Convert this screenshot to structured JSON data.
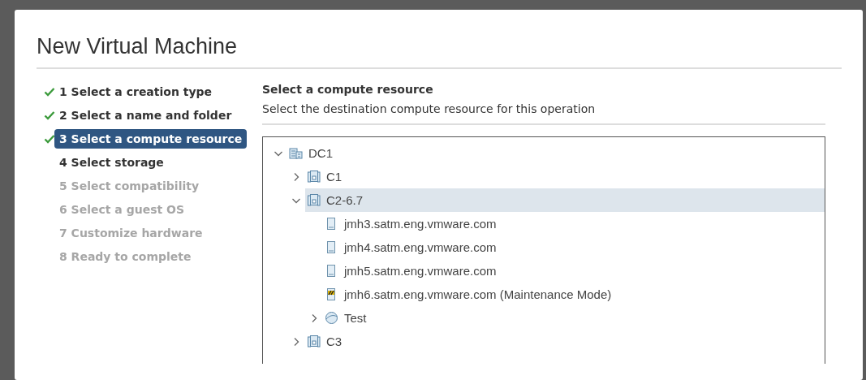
{
  "dialog": {
    "title": "New Virtual Machine"
  },
  "steps": [
    {
      "label": "1 Select a creation type",
      "done": true,
      "selected": false,
      "disabled": false
    },
    {
      "label": "2 Select a name and folder",
      "done": true,
      "selected": false,
      "disabled": false
    },
    {
      "label": "3 Select a compute resource",
      "done": true,
      "selected": true,
      "disabled": false
    },
    {
      "label": "4 Select storage",
      "done": false,
      "selected": false,
      "disabled": false
    },
    {
      "label": "5 Select compatibility",
      "done": false,
      "selected": false,
      "disabled": true
    },
    {
      "label": "6 Select a guest OS",
      "done": false,
      "selected": false,
      "disabled": true
    },
    {
      "label": "7 Customize hardware",
      "done": false,
      "selected": false,
      "disabled": true
    },
    {
      "label": "8 Ready to complete",
      "done": false,
      "selected": false,
      "disabled": true
    }
  ],
  "page": {
    "heading": "Select a compute resource",
    "description": "Select the destination compute resource for this operation"
  },
  "tree": [
    {
      "label": "DC1",
      "kind": "datacenter",
      "expanded": true,
      "selected": false,
      "children": [
        {
          "label": "C1",
          "kind": "cluster",
          "expanded": false,
          "selected": false
        },
        {
          "label": "C2-6.7",
          "kind": "cluster",
          "expanded": true,
          "selected": true,
          "children": [
            {
              "label": "jmh3.satm.eng.vmware.com",
              "kind": "host",
              "selected": false
            },
            {
              "label": "jmh4.satm.eng.vmware.com",
              "kind": "host",
              "selected": false
            },
            {
              "label": "jmh5.satm.eng.vmware.com",
              "kind": "host",
              "selected": false
            },
            {
              "label": "jmh6.satm.eng.vmware.com (Maintenance Mode)",
              "kind": "host-maintenance",
              "selected": false
            },
            {
              "label": "Test",
              "kind": "resource-pool",
              "expanded": false,
              "selected": false
            }
          ]
        },
        {
          "label": "C3",
          "kind": "cluster",
          "expanded": false,
          "selected": false
        }
      ]
    }
  ]
}
